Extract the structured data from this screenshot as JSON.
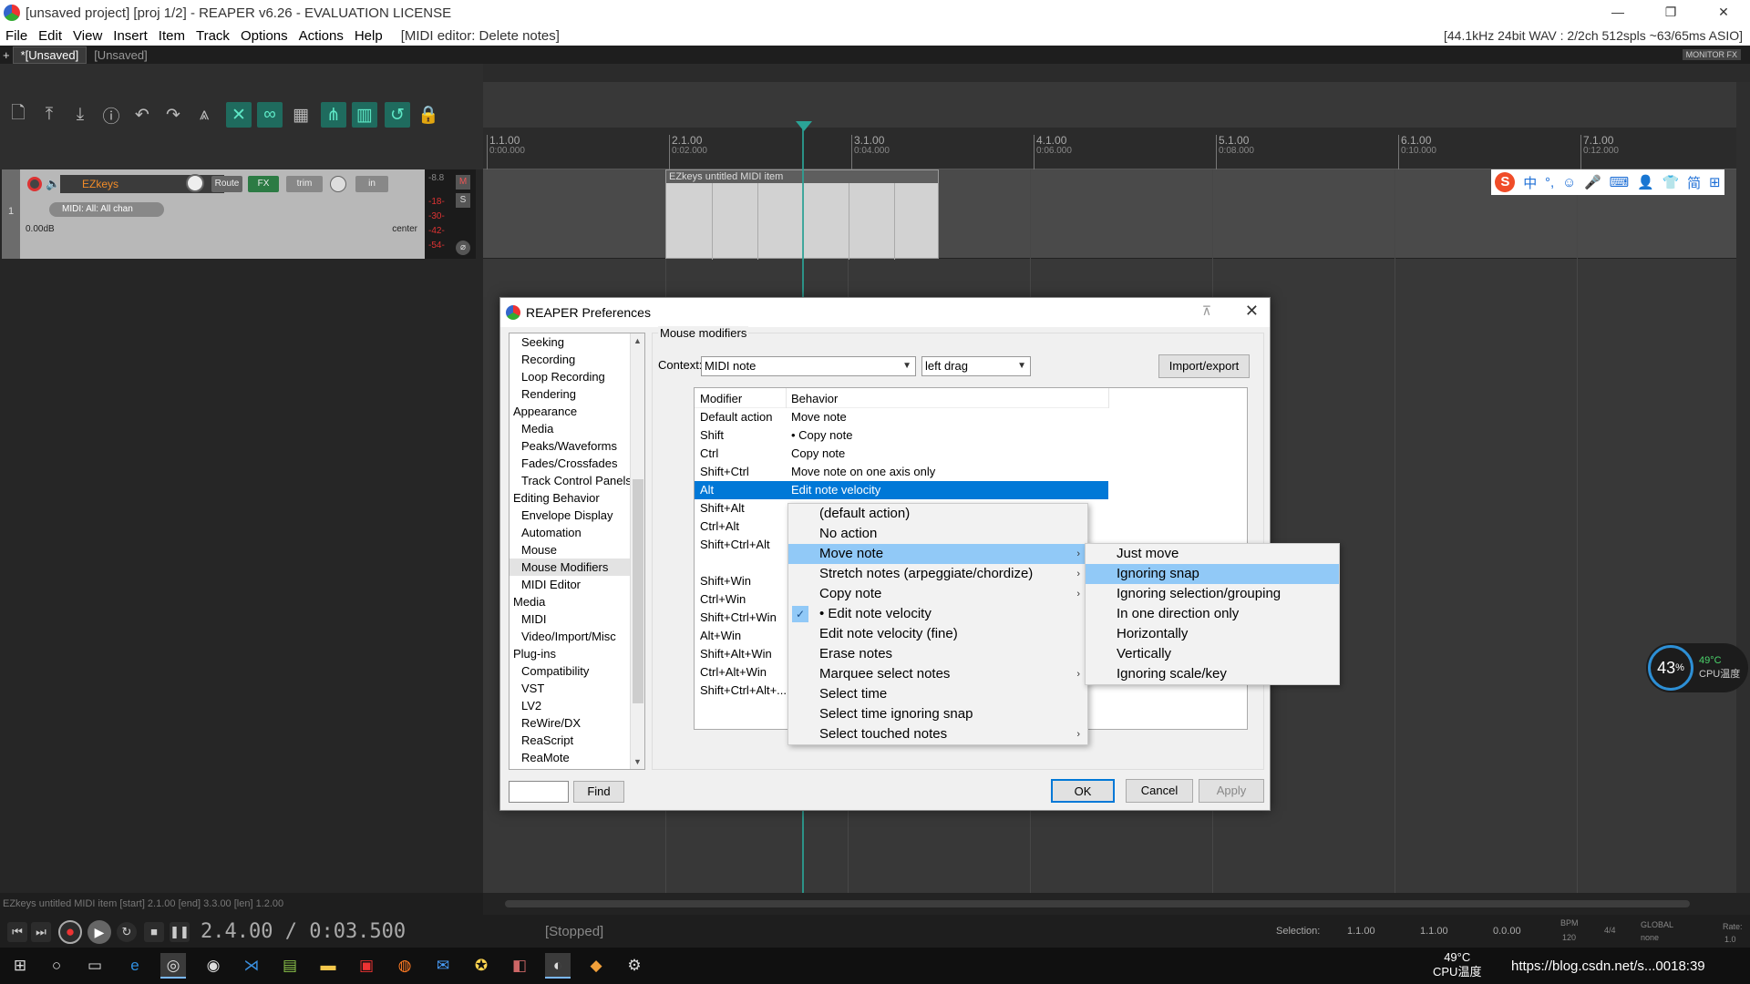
{
  "window": {
    "title": "[unsaved project] [proj 1/2] - REAPER v6.26 - EVALUATION LICENSE",
    "controls": {
      "minimize": "—",
      "restore": "❐",
      "close": "✕"
    }
  },
  "menubar": {
    "items": [
      "File",
      "Edit",
      "View",
      "Insert",
      "Item",
      "Track",
      "Options",
      "Actions",
      "Help"
    ],
    "last_action": "[MIDI editor: Delete notes]",
    "audio_info": "[44.1kHz 24bit WAV : 2/2ch 512spls ~63/65ms ASIO]"
  },
  "project_tabs": {
    "plus": "+",
    "active": "*[Unsaved]",
    "other": "[Unsaved]",
    "monitor_fx": "MONITOR FX"
  },
  "ruler": {
    "marks": [
      {
        "bar": "1.1.00",
        "time": "0:00.000"
      },
      {
        "bar": "2.1.00",
        "time": "0:02.000"
      },
      {
        "bar": "3.1.00",
        "time": "0:04.000"
      },
      {
        "bar": "4.1.00",
        "time": "0:06.000"
      },
      {
        "bar": "5.1.00",
        "time": "0:08.000"
      },
      {
        "bar": "6.1.00",
        "time": "0:10.000"
      },
      {
        "bar": "7.1.00",
        "time": "0:12.000"
      }
    ]
  },
  "track": {
    "number": "1",
    "name": "EZkeys",
    "route_label": "Route",
    "fx_label": "FX",
    "trim_label": "trim",
    "in_label": "in",
    "midi_input": "MIDI: All: All chan",
    "volume": "0.00dB",
    "pan": "center",
    "meter_labels": [
      "-8.8",
      "-18-",
      "-30-",
      "-42-",
      "-54-"
    ],
    "mute_label": "M",
    "solo_label": "S",
    "item_name": "EZkeys untitled MIDI item"
  },
  "ime_toolbar": {
    "logo": "S",
    "icons": [
      "中",
      "°,",
      "☺",
      "🎤",
      "⌨",
      "👤",
      "👕",
      "简",
      "⊞"
    ]
  },
  "cpu_widget": {
    "percent": "43",
    "percent_sign": "%",
    "temp": "49°C",
    "label": "CPU温度"
  },
  "status_line": "EZkeys untitled MIDI item [start] 2.1.00 [end] 3.3.00 [len] 1.2.00",
  "transport": {
    "position": "2.4.00 / 0:03.500",
    "state": "[Stopped]",
    "selection_label": "Selection:",
    "selection_start": "1.1.00",
    "selection_end": "1.1.00",
    "selection_length": "0.0.00",
    "bpm_label": "BPM",
    "bpm": "120",
    "time_sig": "4/4",
    "global_label": "GLOBAL",
    "global_value": "none",
    "rate_label": "Rate:",
    "rate": "1.0"
  },
  "taskbar": {
    "sys_temp": "49°C",
    "sys_temp_label": "CPU温度",
    "watermark": "https://blog.csdn.net/s...0018:39"
  },
  "preferences": {
    "title": "REAPER Preferences",
    "pin": "⊼",
    "close": "✕",
    "tree": [
      {
        "label": "Seeking",
        "level": 2
      },
      {
        "label": "Recording",
        "level": 2
      },
      {
        "label": "Loop Recording",
        "level": 2
      },
      {
        "label": "Rendering",
        "level": 2
      },
      {
        "label": "Appearance",
        "level": 1
      },
      {
        "label": "Media",
        "level": 2
      },
      {
        "label": "Peaks/Waveforms",
        "level": 2
      },
      {
        "label": "Fades/Crossfades",
        "level": 2
      },
      {
        "label": "Track Control Panels",
        "level": 2
      },
      {
        "label": "Editing Behavior",
        "level": 1
      },
      {
        "label": "Envelope Display",
        "level": 2
      },
      {
        "label": "Automation",
        "level": 2
      },
      {
        "label": "Mouse",
        "level": 2
      },
      {
        "label": "Mouse Modifiers",
        "level": 2,
        "selected": true
      },
      {
        "label": "MIDI Editor",
        "level": 2
      },
      {
        "label": "Media",
        "level": 1
      },
      {
        "label": "MIDI",
        "level": 2
      },
      {
        "label": "Video/Import/Misc",
        "level": 2
      },
      {
        "label": "Plug-ins",
        "level": 1
      },
      {
        "label": "Compatibility",
        "level": 2
      },
      {
        "label": "VST",
        "level": 2
      },
      {
        "label": "LV2",
        "level": 2
      },
      {
        "label": "ReWire/DX",
        "level": 2
      },
      {
        "label": "ReaScript",
        "level": 2
      },
      {
        "label": "ReaMote",
        "level": 2
      }
    ],
    "find_value": "",
    "find_label": "Find",
    "group_label": "Mouse modifiers",
    "context_label": "Context:",
    "context_value": "MIDI note",
    "action_value": "left drag",
    "import_export_label": "Import/export",
    "columns": {
      "modifier": "Modifier",
      "behavior": "Behavior"
    },
    "rows": [
      {
        "modifier": "Default action",
        "behavior": "Move note"
      },
      {
        "modifier": "Shift",
        "behavior": "• Copy note"
      },
      {
        "modifier": "Ctrl",
        "behavior": "Copy note"
      },
      {
        "modifier": "Shift+Ctrl",
        "behavior": "Move note on one axis only"
      },
      {
        "modifier": "Alt",
        "behavior": "Edit note velocity",
        "selected": true
      },
      {
        "modifier": "Shift+Alt",
        "behavior": ""
      },
      {
        "modifier": "Ctrl+Alt",
        "behavior": ""
      },
      {
        "modifier": "Shift+Ctrl+Alt",
        "behavior": ""
      },
      {
        "modifier": "",
        "behavior": ""
      },
      {
        "modifier": "Shift+Win",
        "behavior": ""
      },
      {
        "modifier": "Ctrl+Win",
        "behavior": ""
      },
      {
        "modifier": "Shift+Ctrl+Win",
        "behavior": ""
      },
      {
        "modifier": "Alt+Win",
        "behavior": ""
      },
      {
        "modifier": "Shift+Alt+Win",
        "behavior": ""
      },
      {
        "modifier": "Ctrl+Alt+Win",
        "behavior": ""
      },
      {
        "modifier": "Shift+Ctrl+Alt+...",
        "behavior": ""
      }
    ],
    "ok_label": "OK",
    "cancel_label": "Cancel",
    "apply_label": "Apply"
  },
  "context_menu": {
    "items": [
      {
        "label": "(default action)"
      },
      {
        "label": "No action"
      },
      {
        "label": "Move note",
        "submenu": true,
        "highlighted": true
      },
      {
        "label": "Stretch notes (arpeggiate/chordize)",
        "submenu": true
      },
      {
        "label": "Copy note",
        "submenu": true
      },
      {
        "label": "• Edit note velocity",
        "checked": true
      },
      {
        "label": "Edit note velocity (fine)"
      },
      {
        "label": "Erase notes"
      },
      {
        "label": "Marquee select notes",
        "submenu": true
      },
      {
        "label": "Select time"
      },
      {
        "label": "Select time ignoring snap"
      },
      {
        "label": "Select touched notes",
        "submenu": true
      }
    ],
    "check_glyph": "✓",
    "arrow_glyph": "›"
  },
  "submenu": {
    "items": [
      {
        "label": "Just move"
      },
      {
        "label": "Ignoring snap",
        "highlighted": true
      },
      {
        "label": "Ignoring selection/grouping"
      },
      {
        "label": "In one direction only"
      },
      {
        "label": "Horizontally"
      },
      {
        "label": "Vertically"
      },
      {
        "label": "Ignoring scale/key"
      }
    ]
  }
}
